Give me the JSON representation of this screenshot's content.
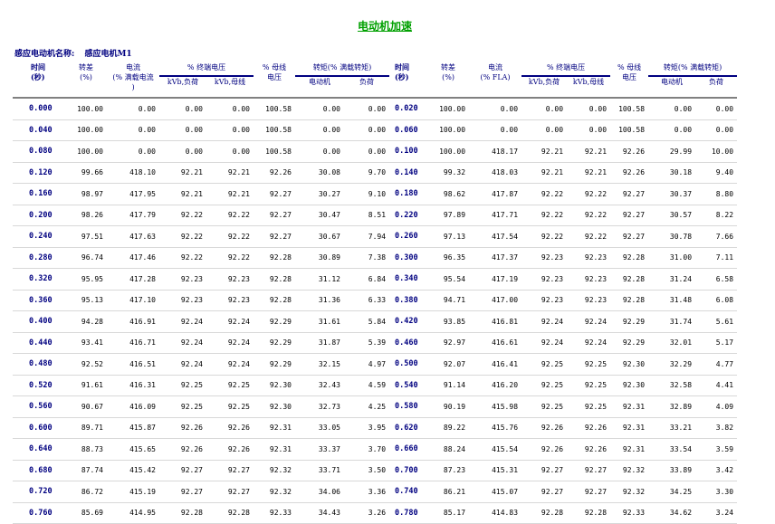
{
  "title": "电动机加速",
  "motor": {
    "label": "感应电动机名称:",
    "value": "感应电机M1"
  },
  "headers": {
    "time": "时间",
    "time_unit": "(秒)",
    "slip": "转差",
    "slip_unit": "(%)",
    "current": "电流",
    "current_unit_left": "(% 满载电流",
    "current_unit_left_cont": ")",
    "current_unit_right": "(% FLA)",
    "terminal_voltage": "% 终端电压",
    "kvb_load": "kVb,负荷",
    "kvb_bus": "kVb,母线",
    "bus_voltage": "% 母线",
    "bus_voltage_unit": "电压",
    "torque": "转矩(% 满载转矩)",
    "torque_motor": "电动机",
    "torque_load": "负荷"
  },
  "rows": [
    {
      "l": [
        "0.000",
        "100.00",
        "0.00",
        "0.00",
        "0.00",
        "100.58",
        "0.00",
        "0.00"
      ],
      "r": [
        "0.020",
        "100.00",
        "0.00",
        "0.00",
        "0.00",
        "100.58",
        "0.00",
        "0.00"
      ]
    },
    {
      "l": [
        "0.040",
        "100.00",
        "0.00",
        "0.00",
        "0.00",
        "100.58",
        "0.00",
        "0.00"
      ],
      "r": [
        "0.060",
        "100.00",
        "0.00",
        "0.00",
        "0.00",
        "100.58",
        "0.00",
        "0.00"
      ]
    },
    {
      "l": [
        "0.080",
        "100.00",
        "0.00",
        "0.00",
        "0.00",
        "100.58",
        "0.00",
        "0.00"
      ],
      "r": [
        "0.100",
        "100.00",
        "418.17",
        "92.21",
        "92.21",
        "92.26",
        "29.99",
        "10.00"
      ]
    },
    {
      "l": [
        "0.120",
        "99.66",
        "418.10",
        "92.21",
        "92.21",
        "92.26",
        "30.08",
        "9.70"
      ],
      "r": [
        "0.140",
        "99.32",
        "418.03",
        "92.21",
        "92.21",
        "92.26",
        "30.18",
        "9.40"
      ]
    },
    {
      "l": [
        "0.160",
        "98.97",
        "417.95",
        "92.21",
        "92.21",
        "92.27",
        "30.27",
        "9.10"
      ],
      "r": [
        "0.180",
        "98.62",
        "417.87",
        "92.22",
        "92.22",
        "92.27",
        "30.37",
        "8.80"
      ]
    },
    {
      "l": [
        "0.200",
        "98.26",
        "417.79",
        "92.22",
        "92.22",
        "92.27",
        "30.47",
        "8.51"
      ],
      "r": [
        "0.220",
        "97.89",
        "417.71",
        "92.22",
        "92.22",
        "92.27",
        "30.57",
        "8.22"
      ]
    },
    {
      "l": [
        "0.240",
        "97.51",
        "417.63",
        "92.22",
        "92.22",
        "92.27",
        "30.67",
        "7.94"
      ],
      "r": [
        "0.260",
        "97.13",
        "417.54",
        "92.22",
        "92.22",
        "92.27",
        "30.78",
        "7.66"
      ]
    },
    {
      "l": [
        "0.280",
        "96.74",
        "417.46",
        "92.22",
        "92.22",
        "92.28",
        "30.89",
        "7.38"
      ],
      "r": [
        "0.300",
        "96.35",
        "417.37",
        "92.23",
        "92.23",
        "92.28",
        "31.00",
        "7.11"
      ]
    },
    {
      "l": [
        "0.320",
        "95.95",
        "417.28",
        "92.23",
        "92.23",
        "92.28",
        "31.12",
        "6.84"
      ],
      "r": [
        "0.340",
        "95.54",
        "417.19",
        "92.23",
        "92.23",
        "92.28",
        "31.24",
        "6.58"
      ]
    },
    {
      "l": [
        "0.360",
        "95.13",
        "417.10",
        "92.23",
        "92.23",
        "92.28",
        "31.36",
        "6.33"
      ],
      "r": [
        "0.380",
        "94.71",
        "417.00",
        "92.23",
        "92.23",
        "92.28",
        "31.48",
        "6.08"
      ]
    },
    {
      "l": [
        "0.400",
        "94.28",
        "416.91",
        "92.24",
        "92.24",
        "92.29",
        "31.61",
        "5.84"
      ],
      "r": [
        "0.420",
        "93.85",
        "416.81",
        "92.24",
        "92.24",
        "92.29",
        "31.74",
        "5.61"
      ]
    },
    {
      "l": [
        "0.440",
        "93.41",
        "416.71",
        "92.24",
        "92.24",
        "92.29",
        "31.87",
        "5.39"
      ],
      "r": [
        "0.460",
        "92.97",
        "416.61",
        "92.24",
        "92.24",
        "92.29",
        "32.01",
        "5.17"
      ]
    },
    {
      "l": [
        "0.480",
        "92.52",
        "416.51",
        "92.24",
        "92.24",
        "92.29",
        "32.15",
        "4.97"
      ],
      "r": [
        "0.500",
        "92.07",
        "416.41",
        "92.25",
        "92.25",
        "92.30",
        "32.29",
        "4.77"
      ]
    },
    {
      "l": [
        "0.520",
        "91.61",
        "416.31",
        "92.25",
        "92.25",
        "92.30",
        "32.43",
        "4.59"
      ],
      "r": [
        "0.540",
        "91.14",
        "416.20",
        "92.25",
        "92.25",
        "92.30",
        "32.58",
        "4.41"
      ]
    },
    {
      "l": [
        "0.560",
        "90.67",
        "416.09",
        "92.25",
        "92.25",
        "92.30",
        "32.73",
        "4.25"
      ],
      "r": [
        "0.580",
        "90.19",
        "415.98",
        "92.25",
        "92.25",
        "92.31",
        "32.89",
        "4.09"
      ]
    },
    {
      "l": [
        "0.600",
        "89.71",
        "415.87",
        "92.26",
        "92.26",
        "92.31",
        "33.05",
        "3.95"
      ],
      "r": [
        "0.620",
        "89.22",
        "415.76",
        "92.26",
        "92.26",
        "92.31",
        "33.21",
        "3.82"
      ]
    },
    {
      "l": [
        "0.640",
        "88.73",
        "415.65",
        "92.26",
        "92.26",
        "92.31",
        "33.37",
        "3.70"
      ],
      "r": [
        "0.660",
        "88.24",
        "415.54",
        "92.26",
        "92.26",
        "92.31",
        "33.54",
        "3.59"
      ]
    },
    {
      "l": [
        "0.680",
        "87.74",
        "415.42",
        "92.27",
        "92.27",
        "92.32",
        "33.71",
        "3.50"
      ],
      "r": [
        "0.700",
        "87.23",
        "415.31",
        "92.27",
        "92.27",
        "92.32",
        "33.89",
        "3.42"
      ]
    },
    {
      "l": [
        "0.720",
        "86.72",
        "415.19",
        "92.27",
        "92.27",
        "92.32",
        "34.06",
        "3.36"
      ],
      "r": [
        "0.740",
        "86.21",
        "415.07",
        "92.27",
        "92.27",
        "92.32",
        "34.25",
        "3.30"
      ]
    },
    {
      "l": [
        "0.760",
        "85.69",
        "414.95",
        "92.28",
        "92.28",
        "92.33",
        "34.43",
        "3.26"
      ],
      "r": [
        "0.780",
        "85.17",
        "414.83",
        "92.28",
        "92.28",
        "92.33",
        "34.62",
        "3.24"
      ]
    }
  ]
}
